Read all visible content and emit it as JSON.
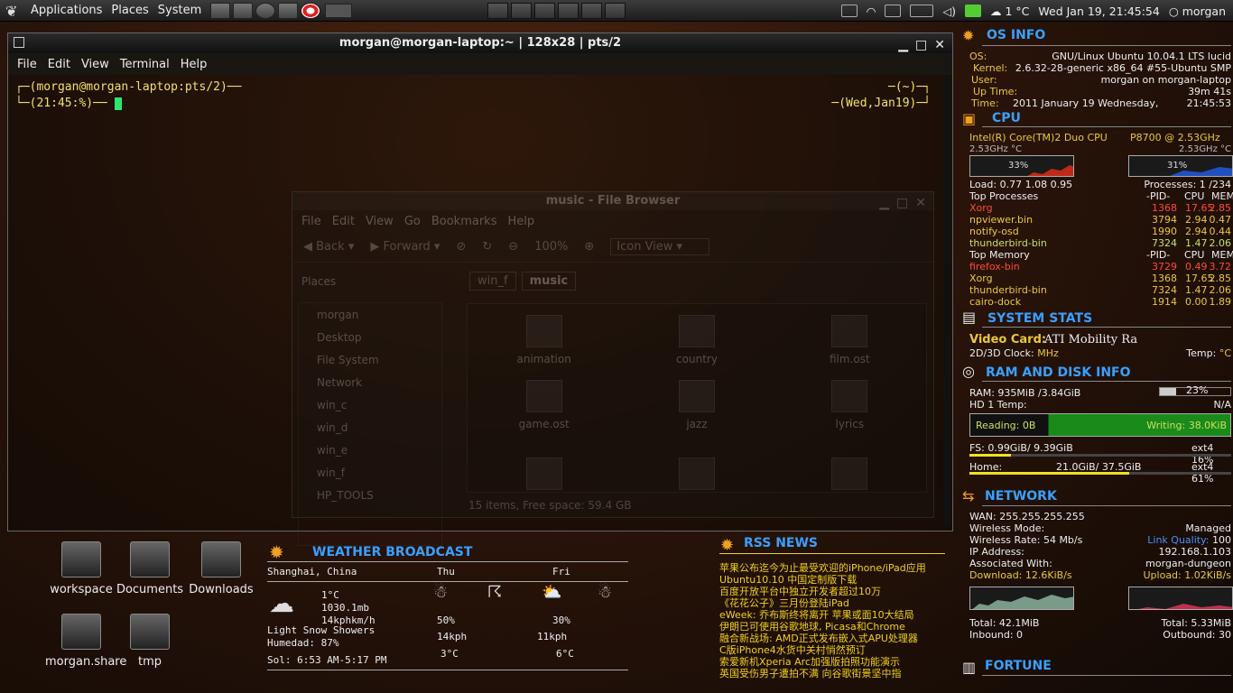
{
  "panel": {
    "menus": [
      "Applications",
      "Places",
      "System"
    ],
    "temp": "1 °C",
    "clock": "Wed Jan 19, 21:45:54",
    "user": "morgan"
  },
  "terminal": {
    "title": "morgan@morgan-laptop:~ | 128x28 | pts/2",
    "menu": [
      "File",
      "Edit",
      "View",
      "Terminal",
      "Help"
    ],
    "line1": "┌─(morgan@morgan-laptop:pts/2)──",
    "line1r": "─(~)─┐",
    "line2": "└─(21:45:%)── ",
    "line2r": "─(Wed,Jan19)─┘"
  },
  "filebrowser": {
    "title": "music - File Browser",
    "menu": [
      "File",
      "Edit",
      "View",
      "Go",
      "Bookmarks",
      "Help"
    ],
    "back": "Back",
    "forward": "Forward",
    "zoom": "100%",
    "view": "Icon View",
    "places_label": "Places",
    "crumb1": "win_f",
    "crumb2": "music",
    "places": [
      "morgan",
      "Desktop",
      "File System",
      "Network",
      "win_c",
      "win_d",
      "win_e",
      "win_f",
      "HP_TOOLS"
    ],
    "files": [
      "animation",
      "country",
      "film.ost",
      "game.ost",
      "jazz",
      "lyrics",
      "",
      "",
      ""
    ],
    "status": "15 items, Free space: 59.4 GB"
  },
  "desktop": {
    "icons": [
      "workspace",
      "Documents",
      "Downloads",
      "morgan.share",
      "tmp"
    ]
  },
  "osinfo": {
    "header": "OS INFO",
    "os_label": "OS:",
    "os": "GNU/Linux Ubuntu 10.04.1 LTS lucid",
    "kernel_label": "Kernel:",
    "kernel": "2.6.32-28-generic x86_64 #55-Ubuntu SMP",
    "user_label": "User:",
    "user": "morgan on morgan-laptop",
    "uptime_label": "Up Time:",
    "uptime": "39m 41s",
    "time_label": "Time:",
    "time_date": "2011 January 19 Wednesday,",
    "time": "21:45:53"
  },
  "cpu": {
    "header": "CPU",
    "model": "Intel(R) Core(TM)2 Duo CPU",
    "model2": "P8700 @ 2.53GHz",
    "freq1": "2.53GHz °C",
    "freq2": "2.53GHz °C",
    "cpu1_pct": "33%",
    "cpu2_pct": "31%",
    "load_label": "Load:",
    "load": "0.77 1.08 0.95",
    "proc_label": "Processes:",
    "proc": "1 /234",
    "top_label": "Top Processes",
    "mem_label": "Top Memory",
    "cols": [
      "-PID-",
      "CPU",
      "MEM"
    ],
    "top": [
      [
        "Xorg",
        "1368",
        "17.65",
        "2.85"
      ],
      [
        "npviewer.bin",
        "3794",
        "2.94",
        "0.47"
      ],
      [
        "notify-osd",
        "1990",
        "2.94",
        "0.44"
      ],
      [
        "thunderbird-bin",
        "7324",
        "1.47",
        "2.06"
      ]
    ],
    "topmem": [
      [
        "firefox-bin",
        "3729",
        "0.49",
        "3.72"
      ],
      [
        "Xorg",
        "1368",
        "17.65",
        "2.85"
      ],
      [
        "thunderbird-bin",
        "7324",
        "1.47",
        "2.06"
      ],
      [
        "cairo-dock",
        "1914",
        "0.00",
        "1.89"
      ]
    ]
  },
  "sysstats": {
    "header": "SYSTEM STATS",
    "vc_label": "Video Card:",
    "vc": "ATI Mobility Ra",
    "clock": "2D/3D Clock:",
    "mhz": "MHz",
    "temp": "Temp:",
    "deg": "°C"
  },
  "ramdisk": {
    "header": "RAM AND DISK INFO",
    "ram": "RAM: 935MiB /3.84GiB",
    "ram_pct": "23%",
    "ram_frac": 0.23,
    "hd_label": "HD 1 Temp:",
    "hd": "N/A",
    "reading": "Reading: 0B",
    "writing": "Writing: 38.0KiB",
    "fs": "FS: 0.99GiB/ 9.39GiB",
    "fs_type": "ext4",
    "fs_pct": "16%",
    "fs_frac": 0.16,
    "home": "Home:",
    "home_val": "21.0GiB/ 37.5GiB",
    "home_type": "ext4",
    "home_pct": "61%",
    "home_frac": 0.61
  },
  "network": {
    "header": "NETWORK",
    "wan": "WAN: 255.255.255.255",
    "mode_label": "Wireless Mode:",
    "mode": "Managed",
    "rate": "Wireless Rate: 54 Mb/s",
    "lq_label": "Link Quality:",
    "lq": "100",
    "ip_label": "IP Address:",
    "ip": "192.168.1.103",
    "assoc_label": "Associated With:",
    "assoc": "morgan-dungeon",
    "down": "Download: 12.6KiB/s",
    "up": "Upload: 1.02KiB/s",
    "total_down": "Total: 42.1MiB",
    "total_up": "Total: 5.33MiB",
    "inbound": "Inbound: 0",
    "outbound": "Outbound: 30"
  },
  "fortune": {
    "header": "FORTUNE"
  },
  "weather": {
    "header": "WEATHER BROADCAST",
    "city": "Shanghai, China",
    "day1": "Thu",
    "day2": "Fri",
    "temp": "1°C",
    "pressure": "1030.1mb",
    "wind": "14kphkm/h",
    "cond": "Light Snow Showers",
    "humid": "Humedad: 87%",
    "sol": "Sol: 6:53 AM-5:17 PM",
    "pop1": "50%",
    "pop2": "30%",
    "w1": "14kph",
    "w2": "11kph",
    "t1": "3°C",
    "t2": "6°C"
  },
  "rss": {
    "header": "RSS NEWS",
    "items": [
      "苹果公布迄今为止最受欢迎的iPhone/iPad应用",
      "Ubuntu10.10 中国定制版下载",
      "百度开放平台中独立开发者超过10万",
      "《花花公子》三月份登陆iPad",
      "eWeek: 乔布斯终将离开 苹果或面10大结局",
      "伊朗已可使用谷歌地球, Picasa和Chrome",
      "融合新战场: AMD正式发布嵌入式APU处理器",
      "C版iPhone4水货中关村悄然预订",
      "索爱新机Xperia Arc加强版拍照功能演示",
      "英国受伤男子遭拍不满 向谷歌街景坚中指"
    ]
  }
}
